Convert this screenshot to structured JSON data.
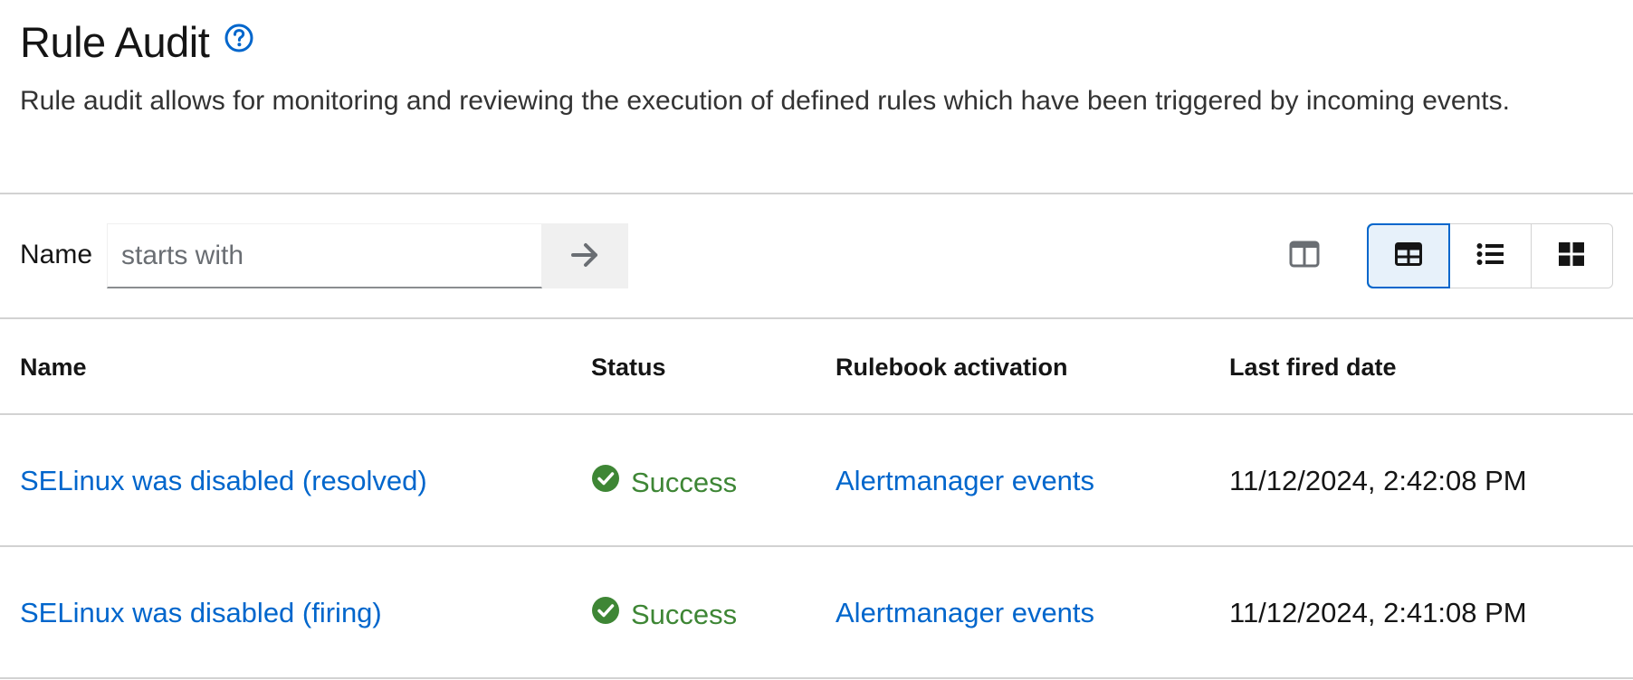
{
  "header": {
    "title": "Rule Audit",
    "help_icon": "question-circle-icon",
    "description": "Rule audit allows for monitoring and reviewing the execution of defined rules which have been triggered by incoming events."
  },
  "toolbar": {
    "filter_label": "Name",
    "filter_placeholder": "starts with",
    "filter_value": "",
    "submit_icon": "arrow-right-icon",
    "columns_icon": "columns-icon",
    "views": [
      {
        "name": "table-view",
        "icon": "table-icon",
        "active": true
      },
      {
        "name": "list-view",
        "icon": "list-icon",
        "active": false
      },
      {
        "name": "card-view",
        "icon": "grid-icon",
        "active": false
      }
    ]
  },
  "table": {
    "columns": [
      "Name",
      "Status",
      "Rulebook activation",
      "Last fired date"
    ],
    "rows": [
      {
        "name": "SELinux was disabled (resolved)",
        "status": "Success",
        "activation": "Alertmanager events",
        "last_fired": "11/12/2024, 2:42:08 PM"
      },
      {
        "name": "SELinux was disabled (firing)",
        "status": "Success",
        "activation": "Alertmanager events",
        "last_fired": "11/12/2024, 2:41:08 PM"
      }
    ]
  },
  "colors": {
    "link": "#0066cc",
    "success": "#3e8635",
    "border": "#d2d2d2"
  }
}
